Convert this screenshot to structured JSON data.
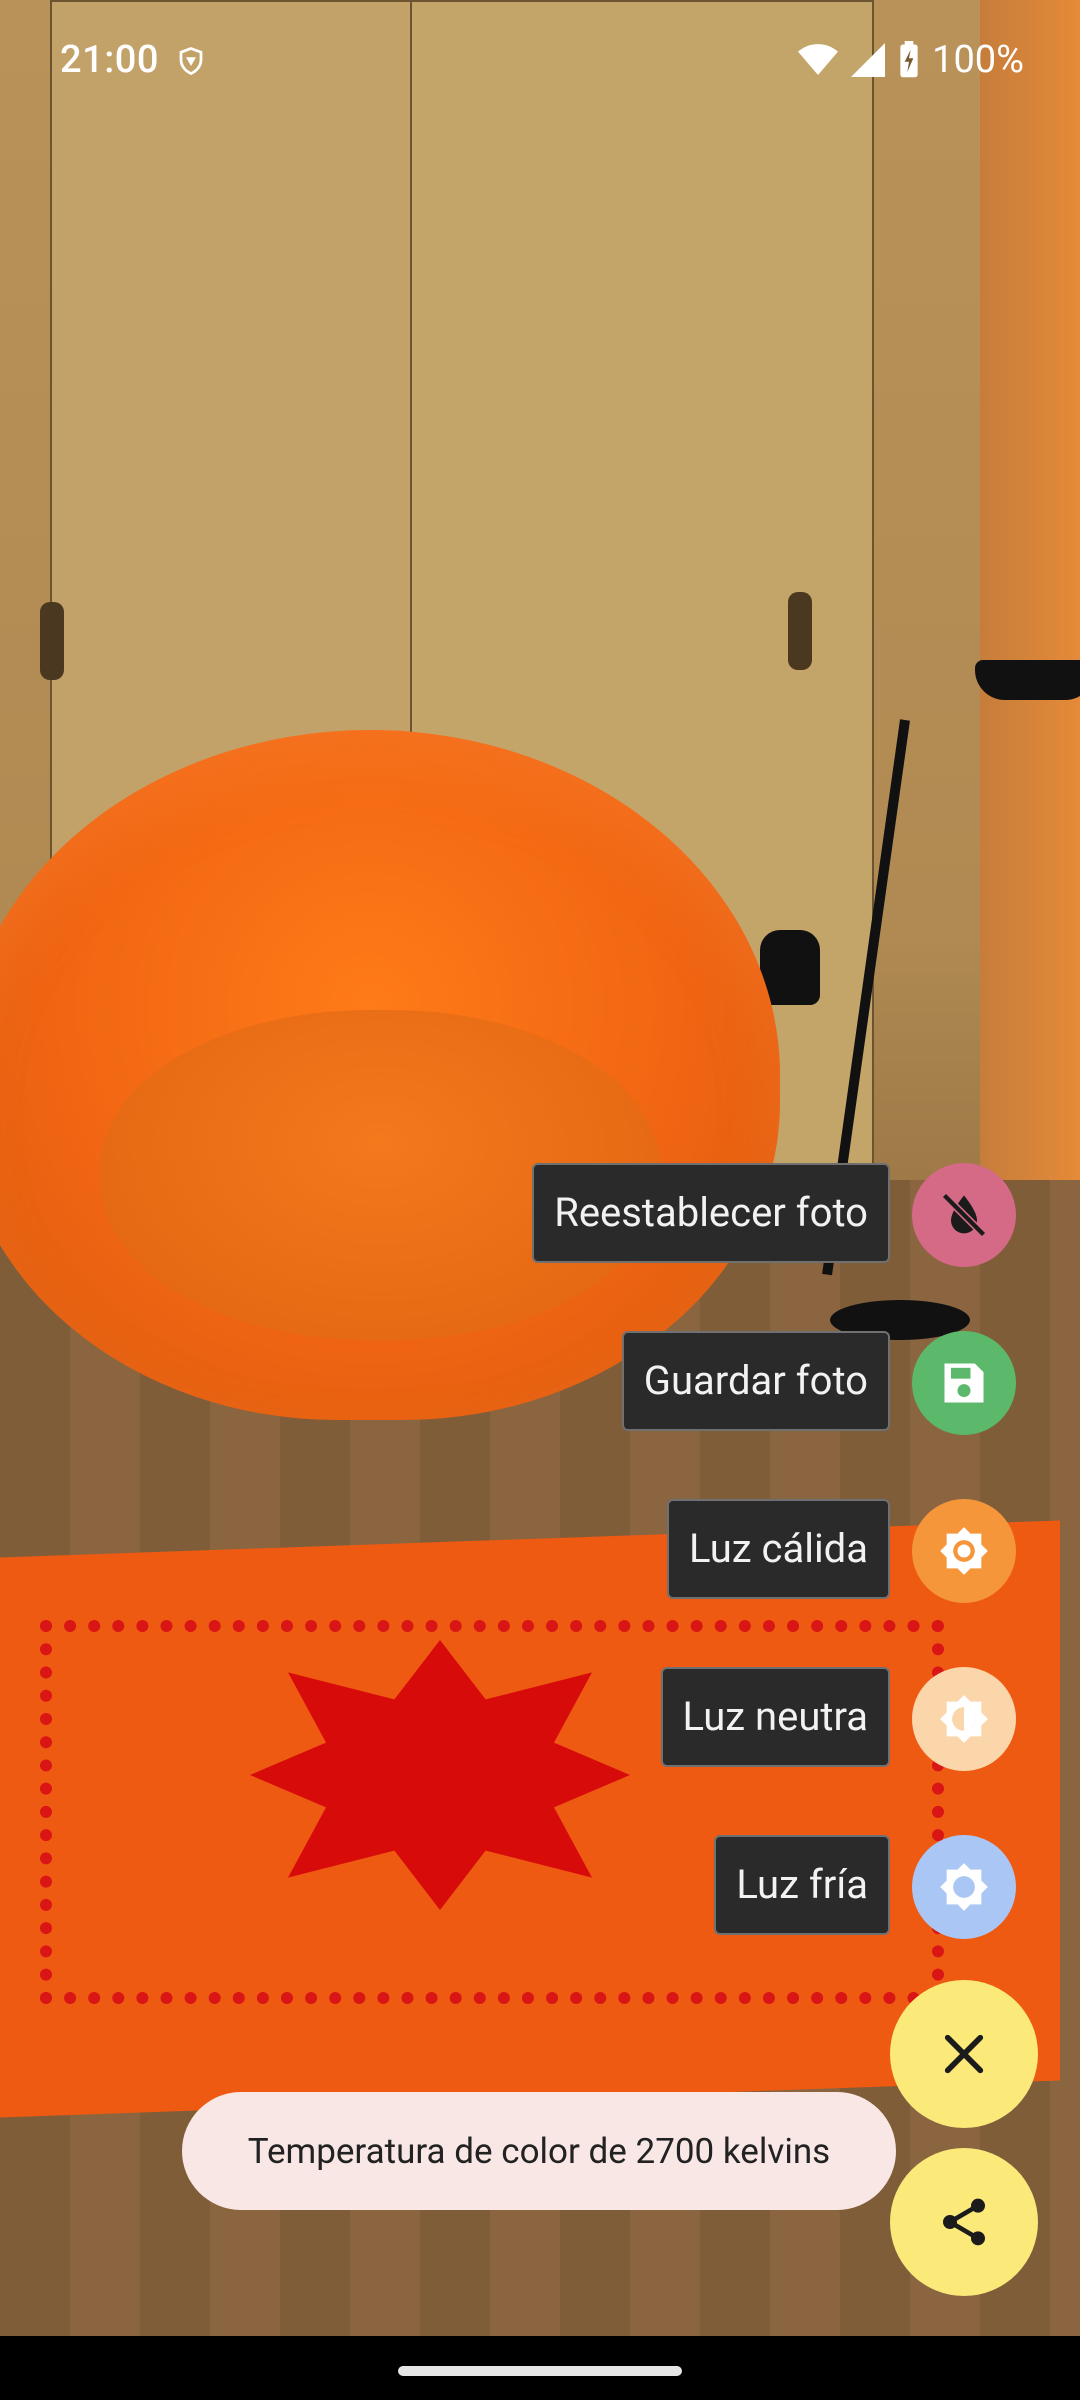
{
  "status_bar": {
    "time": "21:00",
    "battery": "100%",
    "icons": [
      "vpn-shield-icon",
      "wifi-icon",
      "signal-icon",
      "battery-charging-icon"
    ]
  },
  "menu": {
    "items": [
      {
        "label": "Reestablecer foto",
        "icon": "reset-photo-icon",
        "color": "#d46a86"
      },
      {
        "label": "Guardar foto",
        "icon": "save-icon",
        "color": "#5cb86a"
      },
      {
        "label": "Luz cálida",
        "icon": "brightness-high-icon",
        "color": "#f5963b"
      },
      {
        "label": "Luz neutra",
        "icon": "brightness-medium-icon",
        "color": "#fbd6ab"
      },
      {
        "label": "Luz fría",
        "icon": "brightness-low-icon",
        "color": "#a9c6f4"
      }
    ]
  },
  "fab": {
    "close_icon": "close-icon",
    "share_icon": "share-icon",
    "color": "#fbe97a"
  },
  "snackbar": {
    "text": "Temperatura de color de 2700 kelvins"
  }
}
